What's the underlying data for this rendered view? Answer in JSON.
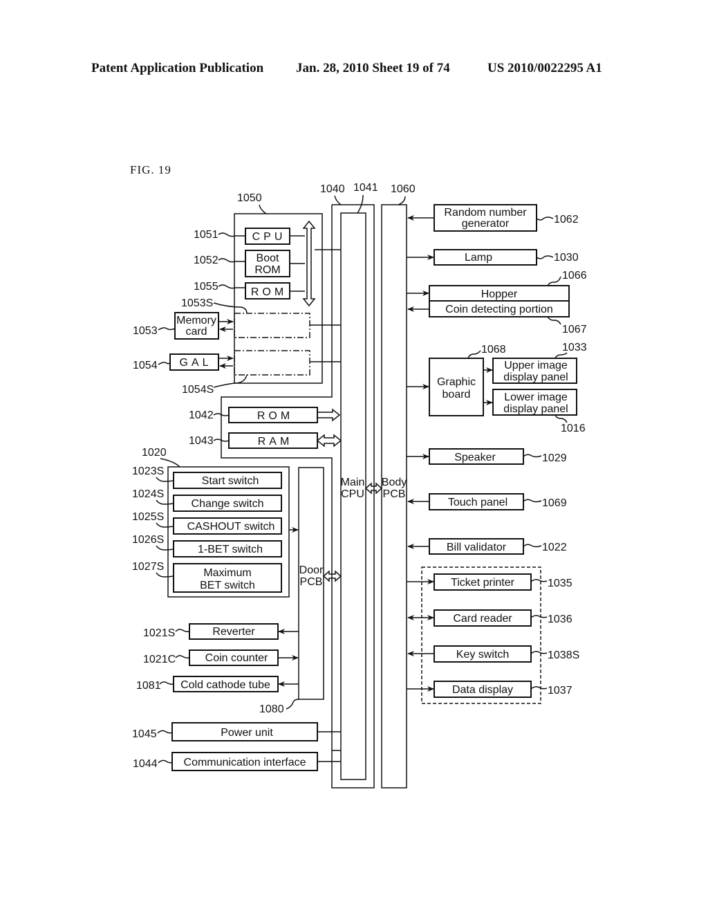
{
  "header": {
    "publication": "Patent Application Publication",
    "date_sheet": "Jan. 28, 2010  Sheet 19 of 74",
    "patent_number": "US 2010/0022295 A1"
  },
  "figure": {
    "label": "FIG. 19"
  },
  "blocks": {
    "cpu": {
      "label": "CPU",
      "ref": "1051"
    },
    "boot_rom": {
      "label_line1": "Boot",
      "label_line2": "ROM",
      "ref": "1052"
    },
    "rom_1055": {
      "label": "ROM",
      "ref": "1055"
    },
    "memory_card": {
      "label_line1": "Memory",
      "label_line2": "card",
      "ref": "1053"
    },
    "memory_card_slot": {
      "ref": "1053S"
    },
    "gal": {
      "label": "GAL",
      "ref": "1054"
    },
    "gal_socket": {
      "ref": "1054S"
    },
    "gaming_board": {
      "ref": "1050"
    },
    "main_pcb": {
      "ref": "1040"
    },
    "main_cpu": {
      "label_line1": "Main",
      "label_line2": "CPU",
      "ref": "1041"
    },
    "body_pcb": {
      "label_line1": "Body",
      "label_line2": "PCB",
      "ref": "1060"
    },
    "rom_1042": {
      "label": "ROM",
      "ref": "1042"
    },
    "ram_1043": {
      "label": "RAM",
      "ref": "1043"
    },
    "switch_group": {
      "ref": "1020"
    },
    "start_switch": {
      "label": "Start switch",
      "ref": "1023S"
    },
    "change_switch": {
      "label": "Change switch",
      "ref": "1024S"
    },
    "cashout_switch": {
      "label": "CASHOUT switch",
      "ref": "1025S"
    },
    "one_bet_switch": {
      "label": "1-BET switch",
      "ref": "1026S"
    },
    "max_bet_switch": {
      "label_line1": "Maximum",
      "label_line2": "BET switch",
      "ref": "1027S"
    },
    "door_pcb": {
      "label_line1": "Door",
      "label_line2": "PCB",
      "ref": "1080"
    },
    "reverter": {
      "label": "Reverter",
      "ref": "1021S"
    },
    "coin_counter": {
      "label": "Coin counter",
      "ref": "1021C"
    },
    "cold_cathode_tube": {
      "label": "Cold cathode tube",
      "ref": "1081"
    },
    "power_unit": {
      "label": "Power unit",
      "ref": "1045"
    },
    "communication_interface": {
      "label": "Communication interface",
      "ref": "1044"
    },
    "random_number_generator": {
      "label_line1": "Random number",
      "label_line2": "generator",
      "ref": "1062"
    },
    "lamp": {
      "label": "Lamp",
      "ref": "1030"
    },
    "hopper": {
      "label": "Hopper",
      "ref": "1066"
    },
    "coin_detecting_portion": {
      "label": "Coin detecting portion",
      "ref": "1067"
    },
    "graphic_board": {
      "label_line1": "Graphic",
      "label_line2": "board",
      "ref": "1068"
    },
    "upper_image_display_panel": {
      "label_line1": "Upper image",
      "label_line2": "display panel",
      "ref": "1033"
    },
    "lower_image_display_panel": {
      "label_line1": "Lower image",
      "label_line2": "display panel",
      "ref": "1016"
    },
    "speaker": {
      "label": "Speaker",
      "ref": "1029"
    },
    "touch_panel": {
      "label": "Touch panel",
      "ref": "1069"
    },
    "bill_validator": {
      "label": "Bill validator",
      "ref": "1022"
    },
    "ticket_printer": {
      "label": "Ticket printer",
      "ref": "1035"
    },
    "card_reader": {
      "label": "Card reader",
      "ref": "1036"
    },
    "key_switch": {
      "label": "Key switch",
      "ref": "1038S"
    },
    "data_display": {
      "label": "Data display",
      "ref": "1037"
    }
  }
}
